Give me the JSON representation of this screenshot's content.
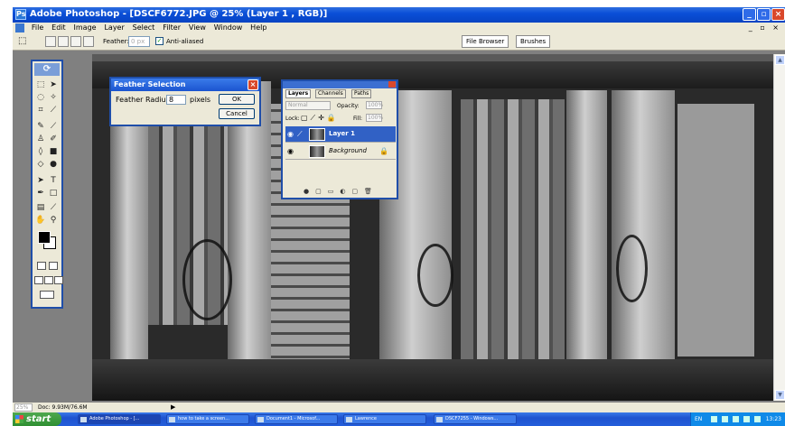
{
  "window": {
    "title": "Adobe Photoshop - [DSCF6772.JPG @ 25% (Layer 1 , RGB)]",
    "app_icon": "photoshop-icon",
    "controls": [
      "minimize-icon",
      "restore-icon",
      "close-icon"
    ]
  },
  "menubar": {
    "items": [
      "File",
      "Edit",
      "Image",
      "Layer",
      "Select",
      "Filter",
      "View",
      "Window",
      "Help"
    ],
    "right_controls": "_ ▫ ×"
  },
  "options_bar": {
    "feather_label": "Feather:",
    "feather_value": "0 px",
    "anti_aliased_label": "Anti-aliased",
    "anti_aliased_checked": true,
    "palette_tabs": [
      "File Browser",
      "Brushes"
    ]
  },
  "feather_dialog": {
    "title": "Feather Selection",
    "radius_label": "Feather Radius:",
    "radius_value": "8",
    "unit": "pixels",
    "ok_label": "OK",
    "cancel_label": "Cancel"
  },
  "layers_palette": {
    "tabs": [
      "Layers",
      "Channels",
      "Paths"
    ],
    "active_tab": "Layers",
    "blend_mode": "Normal",
    "opacity_label": "Opacity:",
    "opacity_value": "100%",
    "lock_label": "Lock:",
    "fill_label": "Fill:",
    "fill_value": "100%",
    "layers": [
      {
        "name": "Layer 1",
        "selected": true
      },
      {
        "name": "Background",
        "selected": false,
        "locked": true
      }
    ]
  },
  "status_bar": {
    "zoom": "25%",
    "doc_info": "Doc: 9.93M/76.6M"
  },
  "taskbar": {
    "start_label": "start",
    "tasks": [
      {
        "label": "Adobe Photoshop - [...",
        "active": true
      },
      {
        "label": "how to take a screen...",
        "active": false
      },
      {
        "label": "Document1 - Microsof...",
        "active": false
      },
      {
        "label": "Lawrence",
        "active": false
      },
      {
        "label": "DSCF7255 - Windows...",
        "active": false
      }
    ],
    "tray_lang": "EN",
    "clock": "13:23"
  },
  "colors": {
    "xp_blue": "#0a4fd8",
    "xp_face": "#ece9d8",
    "selection": "#3161c5",
    "start_green": "#2f8f32"
  }
}
